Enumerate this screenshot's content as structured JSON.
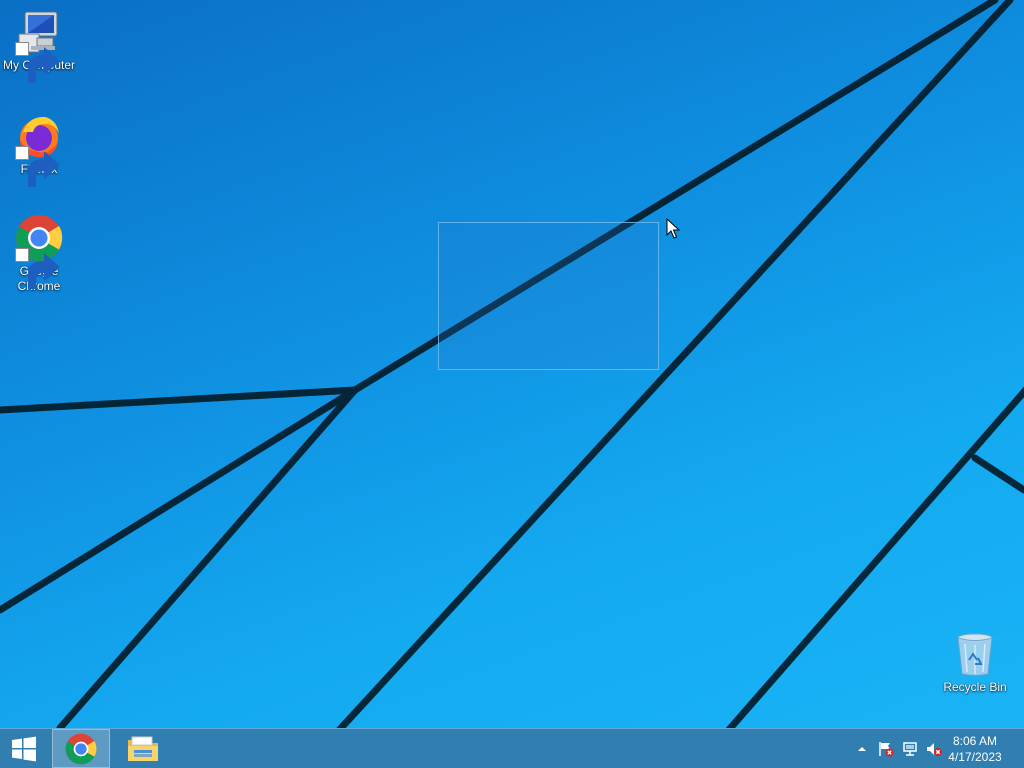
{
  "desktop": {
    "icons": [
      {
        "label": "My Computer",
        "icon": "computer-icon"
      },
      {
        "label": "Firefox",
        "icon": "firefox-icon"
      },
      {
        "label": "Google Chrome",
        "icon": "chrome-icon"
      },
      {
        "label": "Recycle Bin",
        "icon": "recycle-bin-icon"
      }
    ]
  },
  "taskbar": {
    "start_icon": "windows-logo-icon",
    "pinned": [
      {
        "app": "chrome-icon",
        "active": true
      },
      {
        "app": "file-explorer-icon",
        "active": false
      }
    ],
    "tray": {
      "icons": [
        "show-hidden-icons-icon",
        "action-center-flag-icon",
        "network-icon",
        "volume-muted-icon"
      ],
      "time": "8:06 AM",
      "date": "4/17/2023"
    }
  },
  "colors": {
    "wallpaper_top": "#0a6fc4",
    "wallpaper_bottom": "#1ab4f6",
    "taskbar": "#2174aa",
    "text": "#ffffff"
  }
}
